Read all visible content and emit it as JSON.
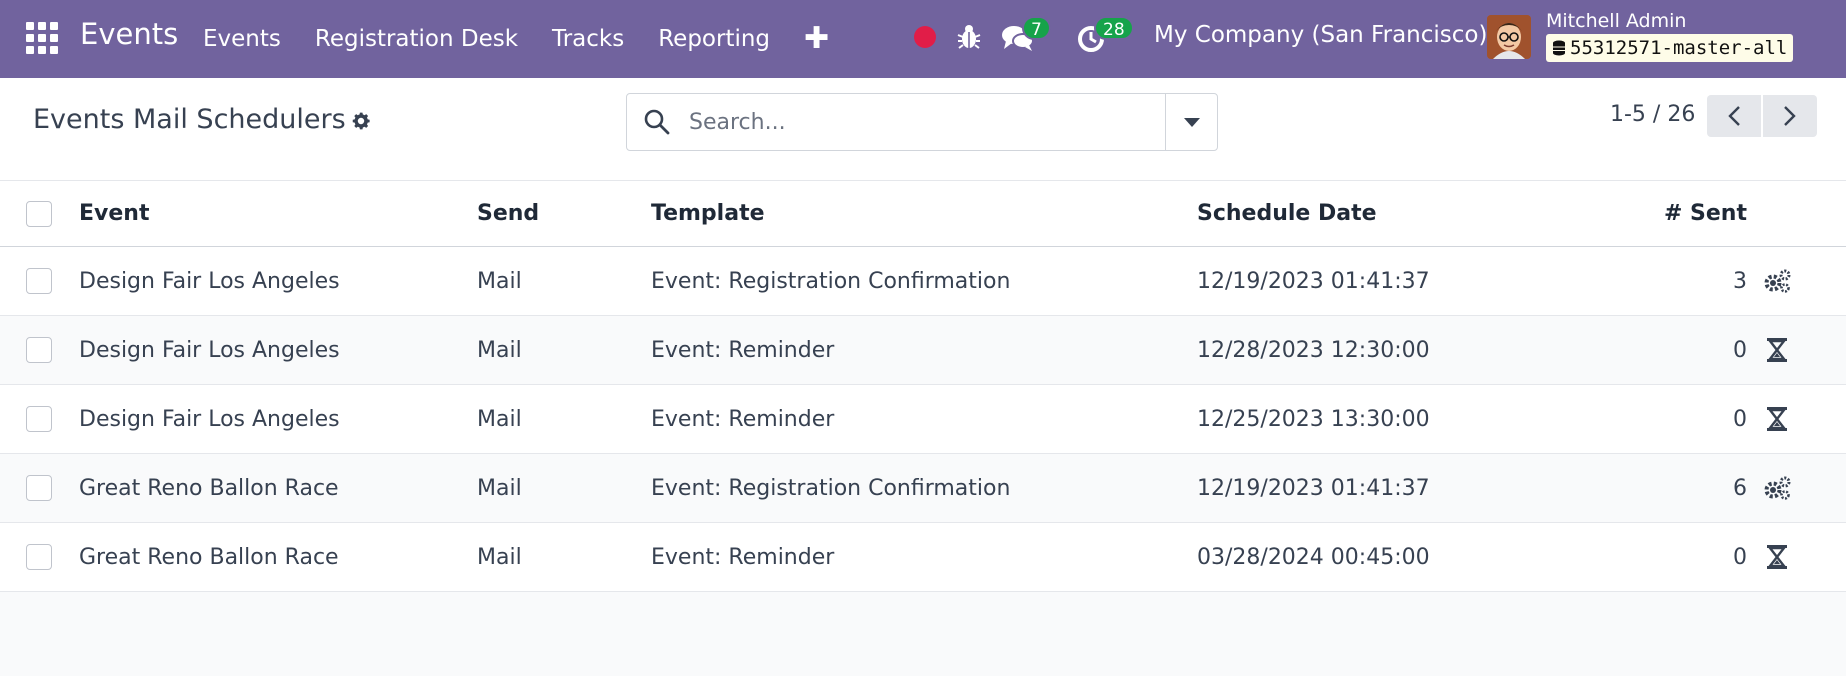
{
  "navbar": {
    "brand": "Events",
    "menu": [
      "Events",
      "Registration Desk",
      "Tracks",
      "Reporting"
    ],
    "chat_count": "7",
    "activity_count": "28",
    "company": "My Company (San Francisco)",
    "user_name": "Mitchell Admin",
    "database": "55312571-master-all",
    "background_color": "#71639e"
  },
  "control": {
    "title": "Events Mail Schedulers",
    "search_placeholder": "Search...",
    "pager": "1-5 / 26"
  },
  "table": {
    "columns": {
      "event": "Event",
      "send": "Send",
      "template": "Template",
      "date": "Schedule Date",
      "sent": "# Sent"
    },
    "rows": [
      {
        "event": "Design Fair Los Angeles",
        "send": "Mail",
        "template": "Event: Registration Confirmation",
        "date": "12/19/2023 01:41:37",
        "sent": "3",
        "state_icon": "gears-icon"
      },
      {
        "event": "Design Fair Los Angeles",
        "send": "Mail",
        "template": "Event: Reminder",
        "date": "12/28/2023 12:30:00",
        "sent": "0",
        "state_icon": "hourglass-icon"
      },
      {
        "event": "Design Fair Los Angeles",
        "send": "Mail",
        "template": "Event: Reminder",
        "date": "12/25/2023 13:30:00",
        "sent": "0",
        "state_icon": "hourglass-icon"
      },
      {
        "event": "Great Reno Ballon Race",
        "send": "Mail",
        "template": "Event: Registration Confirmation",
        "date": "12/19/2023 01:41:37",
        "sent": "6",
        "state_icon": "gears-icon"
      },
      {
        "event": "Great Reno Ballon Race",
        "send": "Mail",
        "template": "Event: Reminder",
        "date": "03/28/2024 00:45:00",
        "sent": "0",
        "state_icon": "hourglass-icon"
      }
    ]
  }
}
